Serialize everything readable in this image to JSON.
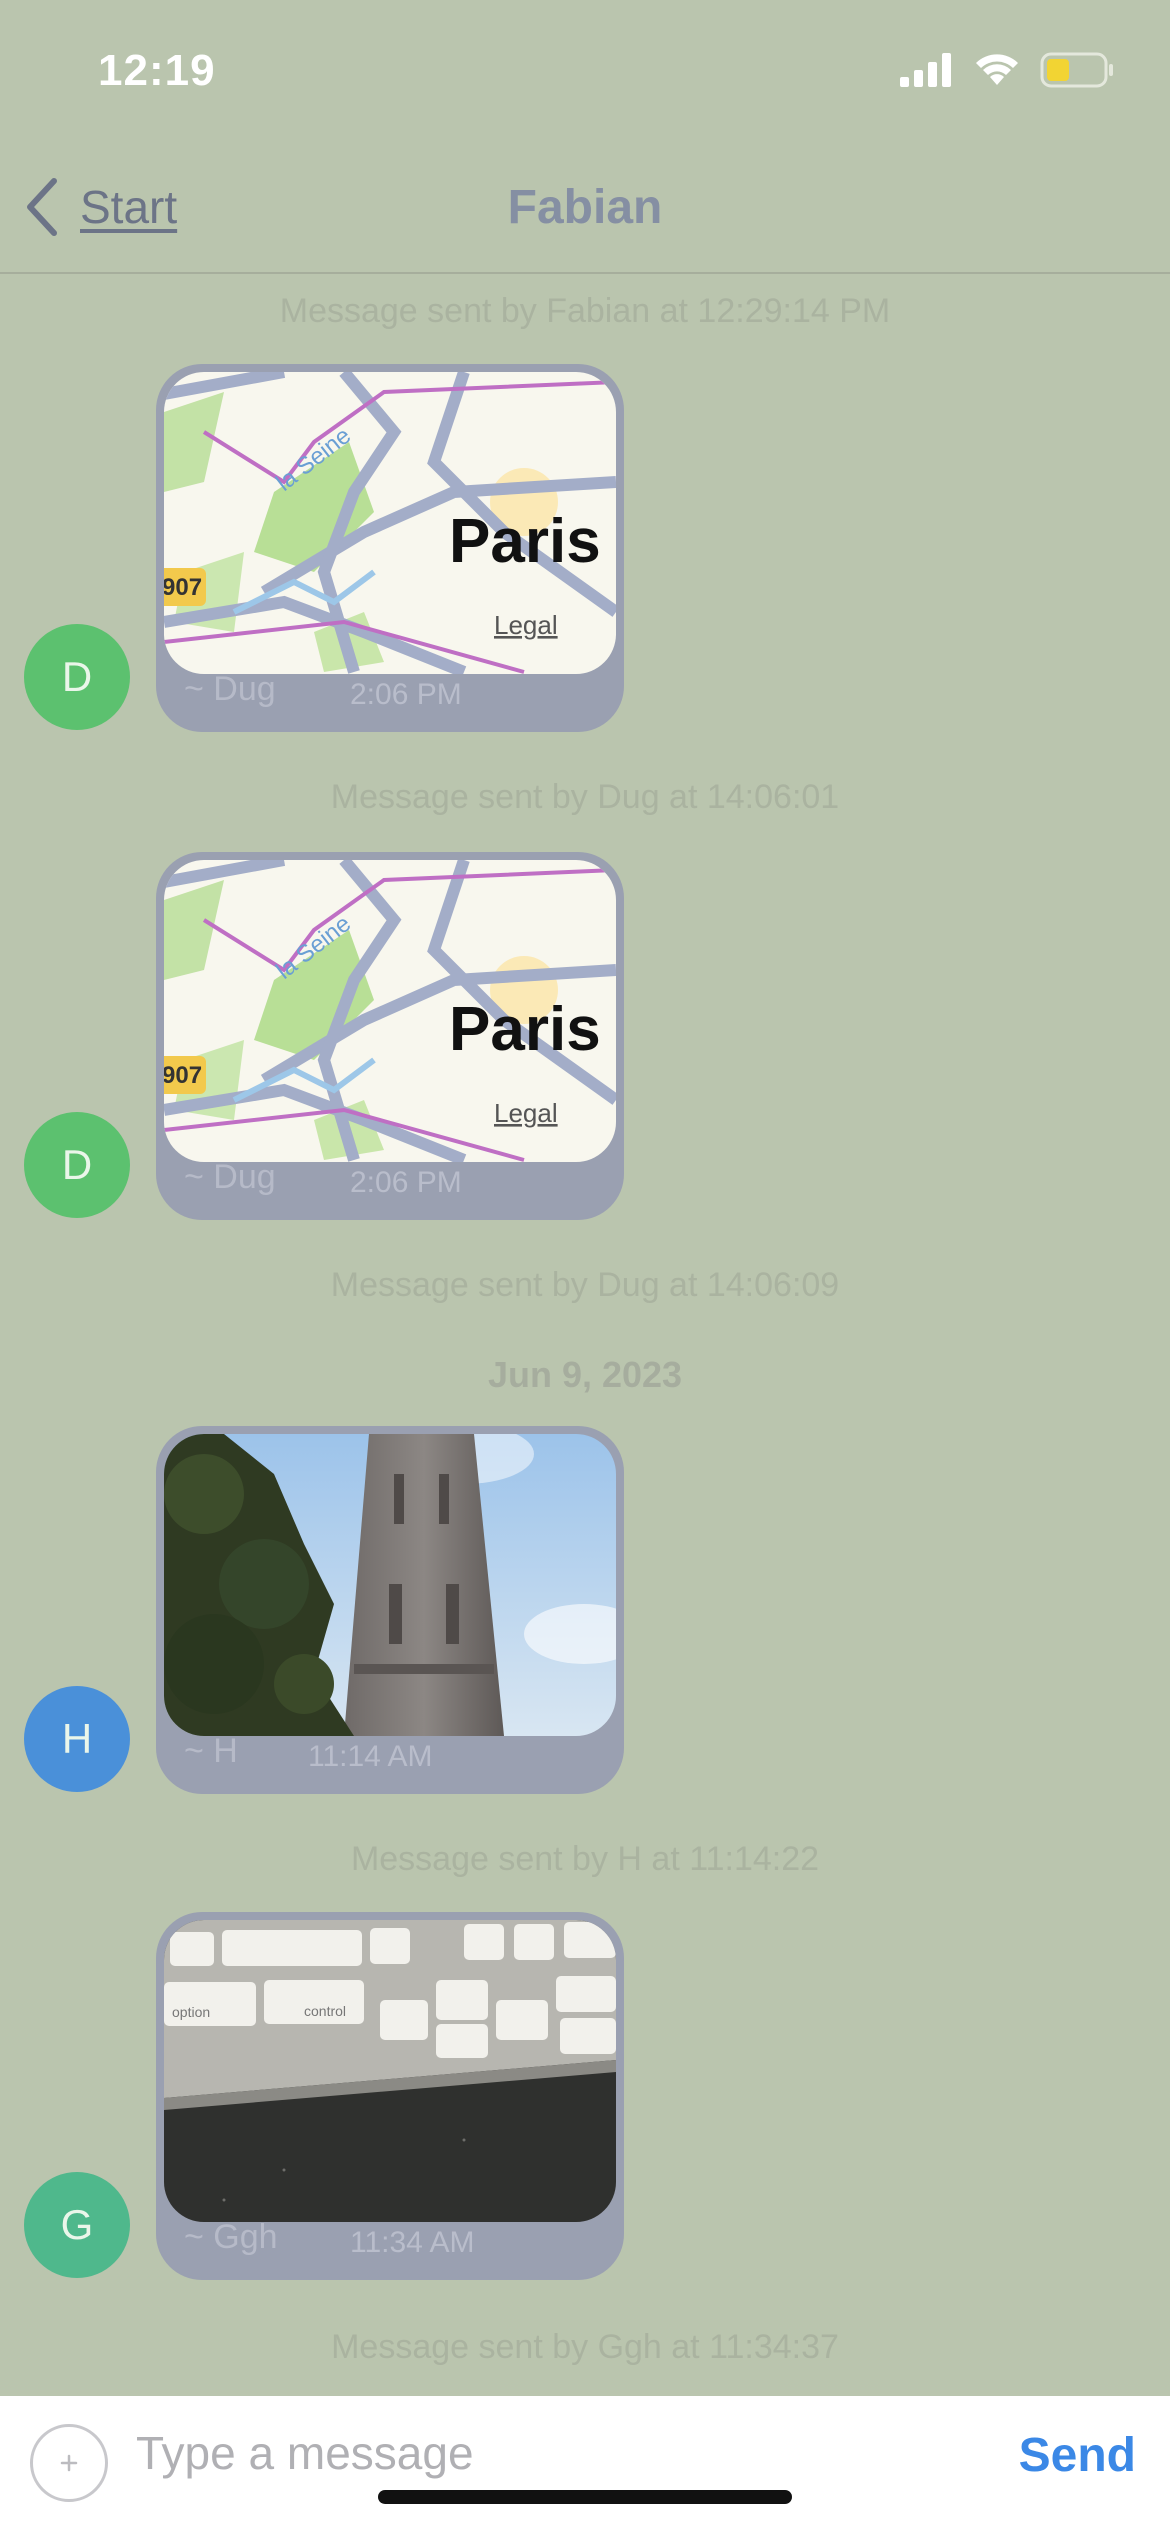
{
  "status_bar": {
    "time": "12:19"
  },
  "nav": {
    "back_label": "Start",
    "title": "Fabian"
  },
  "feed": {
    "system_messages": [
      "Message sent by Fabian at 12:29:14 PM",
      "Message sent by Dug at 14:06:01",
      "Message sent by Dug at 14:06:09",
      "Message sent by H at 11:14:22",
      "Message sent by Ggh at 11:34:37"
    ],
    "date_separator": "Jun 9, 2023",
    "messages": [
      {
        "avatar_initial": "D",
        "avatar_color": "#5cc16f",
        "sender": "~ Dug",
        "time": "2:06 PM",
        "media": "map",
        "map_city": "Paris",
        "map_river": "la Seine",
        "map_legal": "Legal",
        "map_route": "907"
      },
      {
        "avatar_initial": "D",
        "avatar_color": "#5cc16f",
        "sender": "~ Dug",
        "time": "2:06 PM",
        "media": "map",
        "map_city": "Paris",
        "map_river": "la Seine",
        "map_legal": "Legal",
        "map_route": "907"
      },
      {
        "avatar_initial": "H",
        "avatar_color": "#4a90d9",
        "sender": "~ H",
        "time": "11:14 AM",
        "media": "photo-tower"
      },
      {
        "avatar_initial": "G",
        "avatar_color": "#4fb88c",
        "sender": "~ Ggh",
        "time": "11:34 AM",
        "media": "photo-keyboard",
        "key_labels": [
          "option",
          "control"
        ]
      }
    ]
  },
  "composer": {
    "placeholder": "Type a message",
    "send_label": "Send",
    "attach_icon": "plus-icon"
  }
}
